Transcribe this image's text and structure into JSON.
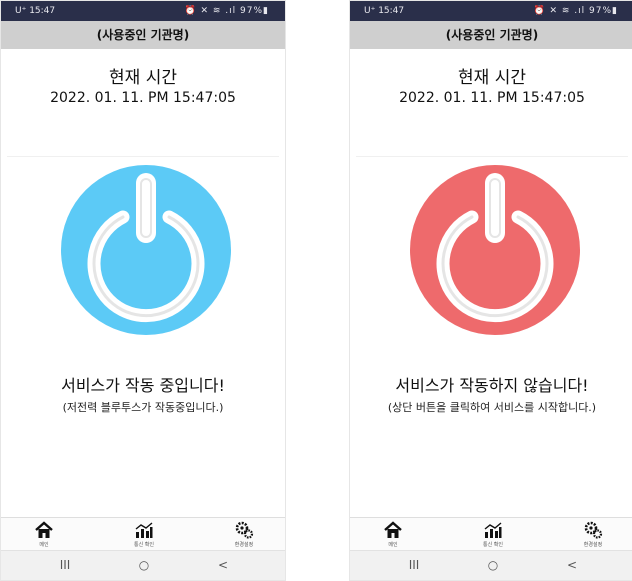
{
  "screens": [
    {
      "state": "running",
      "status": {
        "carrier_time": "U⁺ 15:47",
        "indicators": "⏰ ✕ ≋ .ıl 97%▮"
      },
      "appbar_title": "(사용중인 기관명)",
      "time_label": "현재 시간",
      "time_value": "2022. 01. 11. PM 15:47:05",
      "power_color": "#5ccaf6",
      "message": "서비스가 작동 중입니다!",
      "sub_message": "(저전력 블루투스가 작동중입니다.)",
      "nav": [
        {
          "label": "메인",
          "icon": "home-icon"
        },
        {
          "label": "통신 확인",
          "icon": "chart-icon"
        },
        {
          "label": "환경설정",
          "icon": "gears-icon"
        }
      ],
      "sys": {
        "recents": "III",
        "home": "○",
        "back": "<"
      }
    },
    {
      "state": "stopped",
      "status": {
        "carrier_time": "U⁺ 15:47",
        "indicators": "⏰ ✕ ≋ .ıl 97%▮"
      },
      "appbar_title": "(사용중인 기관명)",
      "time_label": "현재 시간",
      "time_value": "2022. 01. 11. PM 15:47:05",
      "power_color": "#ee6a6c",
      "message": "서비스가 작동하지 않습니다!",
      "sub_message": "(상단 버튼을 클릭하여 서비스를 시작합니다.)",
      "nav": [
        {
          "label": "메인",
          "icon": "home-icon"
        },
        {
          "label": "통신 확인",
          "icon": "chart-icon"
        },
        {
          "label": "환경설정",
          "icon": "gears-icon"
        }
      ],
      "sys": {
        "recents": "III",
        "home": "○",
        "back": "<"
      }
    }
  ]
}
